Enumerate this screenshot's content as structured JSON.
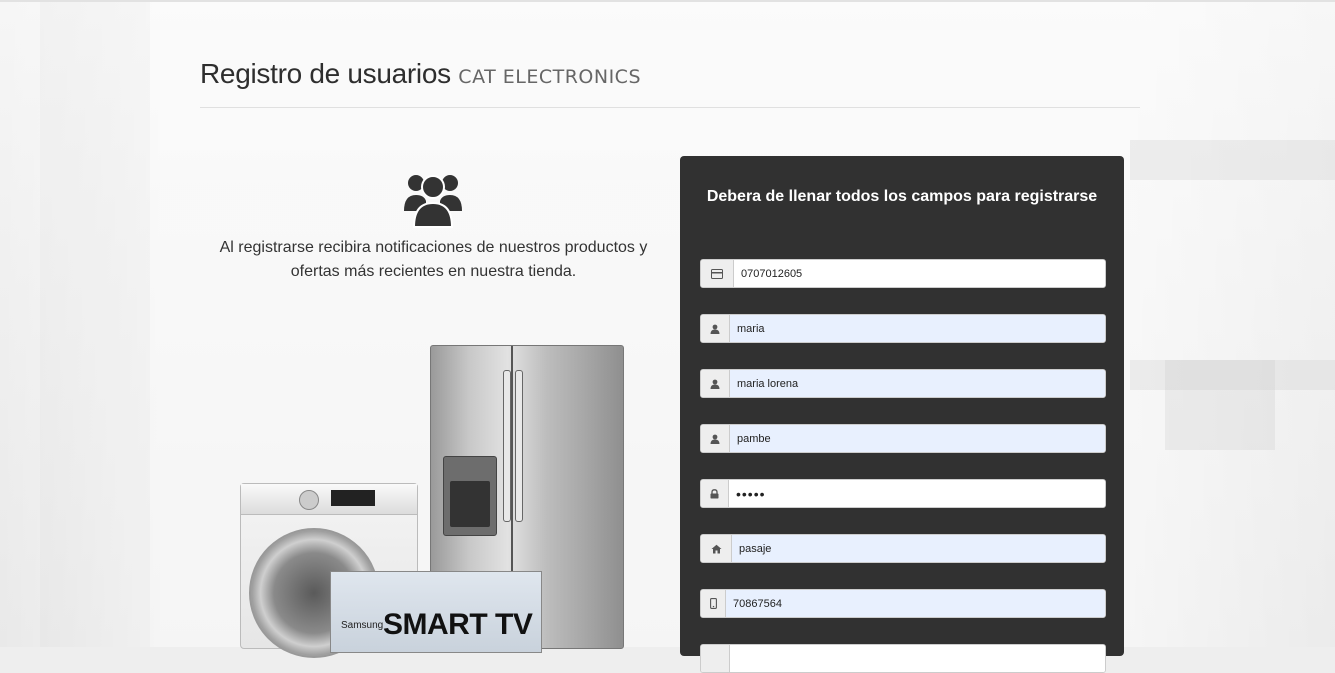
{
  "header": {
    "title": "Registro de usuarios",
    "brand": "CAT ELECTRONICS"
  },
  "intro": {
    "icon": "users-icon",
    "text": "Al registrarse recibira notificaciones de nuestros productos y ofertas más recientes en nuestra tienda."
  },
  "product_image": {
    "tv_brand": "Samsung",
    "tv_logo": "SMART TV"
  },
  "form": {
    "title": "Debera de llenar todos los campos para registrarse",
    "fields": [
      {
        "icon": "id-card-icon",
        "value": "0707012605"
      },
      {
        "icon": "user-icon",
        "value": "maria"
      },
      {
        "icon": "user-icon",
        "value": "maria lorena"
      },
      {
        "icon": "user-icon",
        "value": "pambe"
      },
      {
        "icon": "lock-icon",
        "value": "•••••"
      },
      {
        "icon": "home-icon",
        "value": "pasaje"
      },
      {
        "icon": "mobile-phone-icon",
        "value": "70867564"
      }
    ]
  },
  "colors": {
    "panel_bg": "#313131",
    "autofill_bg": "#e8f0fe",
    "addon_bg": "#eeeeee"
  }
}
